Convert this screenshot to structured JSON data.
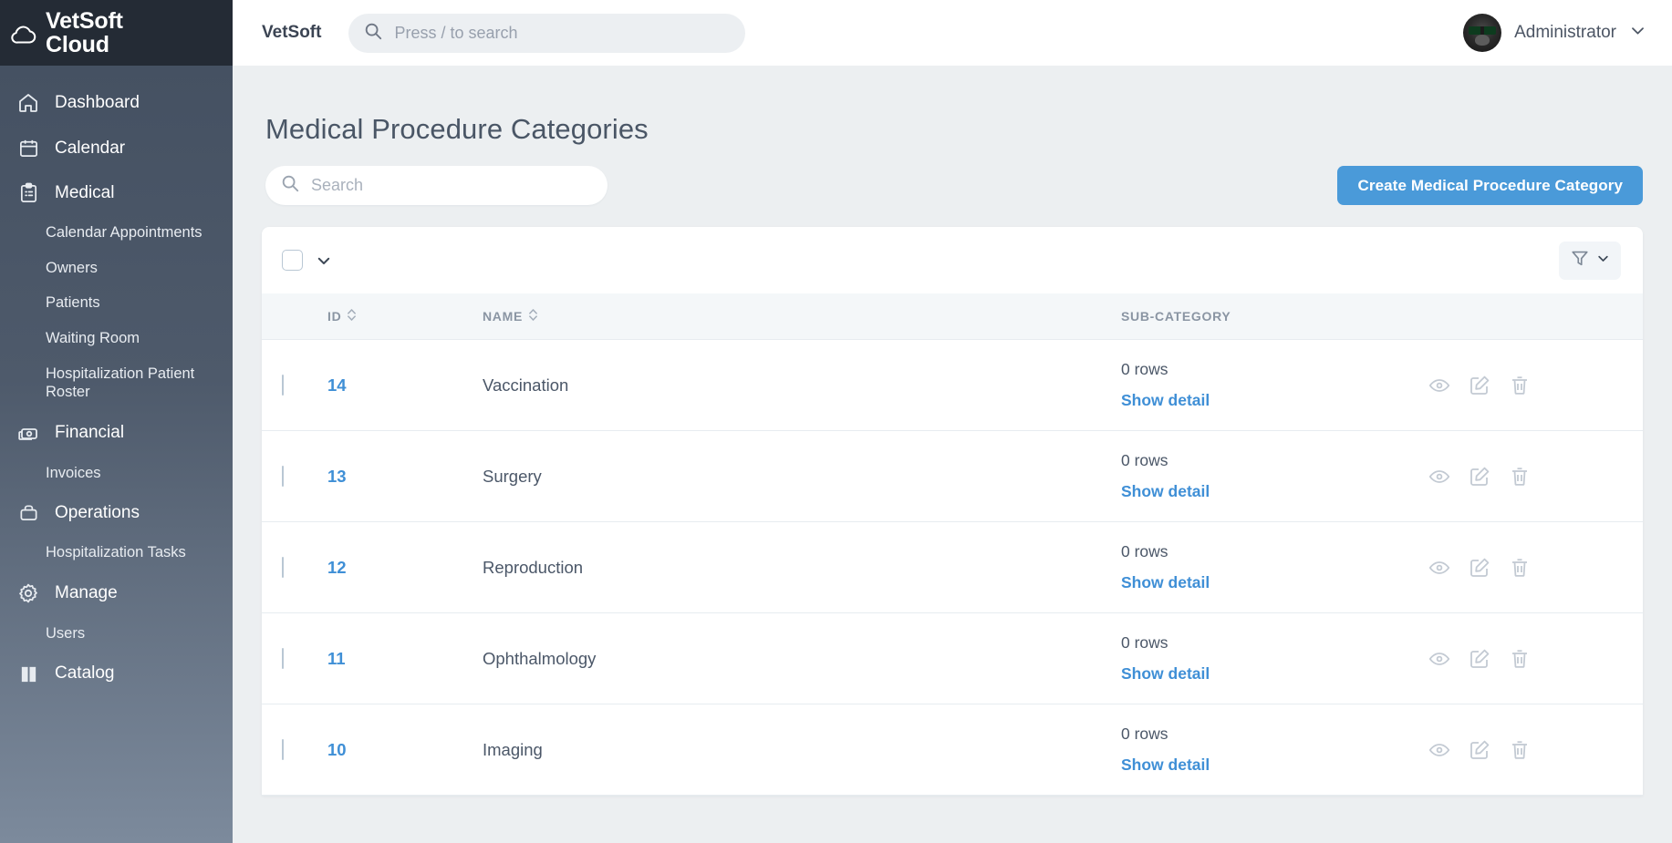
{
  "sidebar": {
    "logo": {
      "line1": "VetSoft",
      "line2": "Cloud",
      "icon": "cloud-icon"
    },
    "items": [
      {
        "label": "Dashboard",
        "type": "group",
        "icon": "home-icon"
      },
      {
        "label": "Calendar",
        "type": "group",
        "icon": "calendar-icon"
      },
      {
        "label": "Medical",
        "type": "group",
        "icon": "clipboard-icon"
      },
      {
        "label": "Calendar Appointments",
        "type": "sub"
      },
      {
        "label": "Owners",
        "type": "sub"
      },
      {
        "label": "Patients",
        "type": "sub"
      },
      {
        "label": "Waiting Room",
        "type": "sub"
      },
      {
        "label": "Hospitalization Patient Roster",
        "type": "sub"
      },
      {
        "label": "Financial",
        "type": "group",
        "icon": "money-icon"
      },
      {
        "label": "Invoices",
        "type": "sub"
      },
      {
        "label": "Operations",
        "type": "group",
        "icon": "briefcase-icon"
      },
      {
        "label": "Hospitalization Tasks",
        "type": "sub"
      },
      {
        "label": "Manage",
        "type": "group",
        "icon": "gear-icon"
      },
      {
        "label": "Users",
        "type": "sub"
      },
      {
        "label": "Catalog",
        "type": "group",
        "icon": "book-icon"
      }
    ]
  },
  "topbar": {
    "brand": "VetSoft",
    "search_placeholder": "Press / to search",
    "user_name": "Administrator"
  },
  "page": {
    "title": "Medical Procedure Categories",
    "search_placeholder": "Search",
    "create_button": "Create Medical Procedure Category"
  },
  "table": {
    "columns": [
      "ID",
      "NAME",
      "SUB-CATEGORY"
    ],
    "rows": [
      {
        "id": "14",
        "name": "Vaccination",
        "sub_count": "0 rows",
        "sub_link": "Show detail"
      },
      {
        "id": "13",
        "name": "Surgery",
        "sub_count": "0 rows",
        "sub_link": "Show detail"
      },
      {
        "id": "12",
        "name": "Reproduction",
        "sub_count": "0 rows",
        "sub_link": "Show detail"
      },
      {
        "id": "11",
        "name": "Ophthalmology",
        "sub_count": "0 rows",
        "sub_link": "Show detail"
      },
      {
        "id": "10",
        "name": "Imaging",
        "sub_count": "0 rows",
        "sub_link": "Show detail"
      }
    ],
    "row_actions": [
      "view-eye-icon",
      "edit-pencil-icon",
      "delete-trash-icon"
    ]
  },
  "colors": {
    "accent_blue": "#4a9ad9",
    "link_blue": "#3f8fd6",
    "sidebar_dark": "#242b35",
    "content_bg": "#eceff1"
  }
}
